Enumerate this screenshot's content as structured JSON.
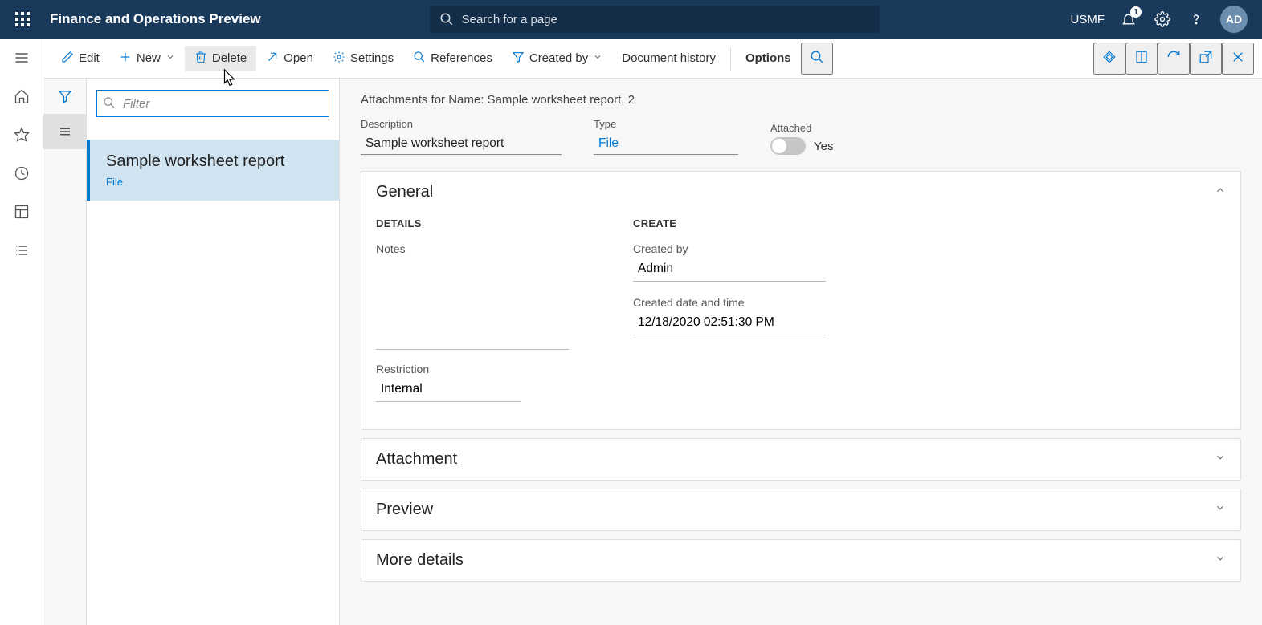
{
  "header": {
    "app_title": "Finance and Operations Preview",
    "search_placeholder": "Search for a page",
    "company": "USMF",
    "notification_count": "1",
    "avatar_initials": "AD"
  },
  "action_pane": {
    "edit": "Edit",
    "new": "New",
    "delete": "Delete",
    "open": "Open",
    "settings": "Settings",
    "references": "References",
    "created_by": "Created by",
    "document_history": "Document history",
    "options": "Options"
  },
  "list": {
    "filter_placeholder": "Filter",
    "items": [
      {
        "title": "Sample worksheet report",
        "subtitle": "File"
      }
    ]
  },
  "detail": {
    "breadcrumb": "Attachments for Name: Sample worksheet report, 2",
    "header_fields": {
      "description_label": "Description",
      "description_value": "Sample worksheet report",
      "type_label": "Type",
      "type_value": "File",
      "attached_label": "Attached",
      "attached_value": "Yes"
    },
    "sections": {
      "general": {
        "title": "General",
        "details_heading": "DETAILS",
        "notes_label": "Notes",
        "restriction_label": "Restriction",
        "restriction_value": "Internal",
        "create_heading": "CREATE",
        "created_by_label": "Created by",
        "created_by_value": "Admin",
        "created_dt_label": "Created date and time",
        "created_dt_value": "12/18/2020 02:51:30 PM"
      },
      "attachment": {
        "title": "Attachment"
      },
      "preview": {
        "title": "Preview"
      },
      "more_details": {
        "title": "More details"
      }
    }
  }
}
